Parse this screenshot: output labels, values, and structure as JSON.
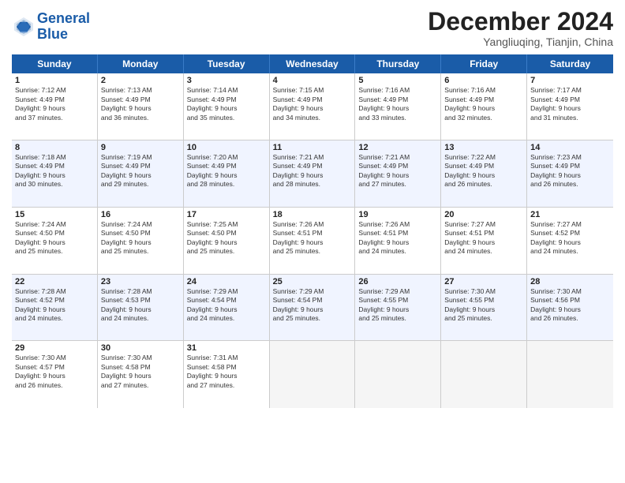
{
  "header": {
    "logo_line1": "General",
    "logo_line2": "Blue",
    "month_title": "December 2024",
    "location": "Yangliuqing, Tianjin, China"
  },
  "weekdays": [
    "Sunday",
    "Monday",
    "Tuesday",
    "Wednesday",
    "Thursday",
    "Friday",
    "Saturday"
  ],
  "weeks": [
    [
      {
        "day": "1",
        "lines": [
          "Sunrise: 7:12 AM",
          "Sunset: 4:49 PM",
          "Daylight: 9 hours",
          "and 37 minutes."
        ],
        "alt": false,
        "empty": false
      },
      {
        "day": "2",
        "lines": [
          "Sunrise: 7:13 AM",
          "Sunset: 4:49 PM",
          "Daylight: 9 hours",
          "and 36 minutes."
        ],
        "alt": false,
        "empty": false
      },
      {
        "day": "3",
        "lines": [
          "Sunrise: 7:14 AM",
          "Sunset: 4:49 PM",
          "Daylight: 9 hours",
          "and 35 minutes."
        ],
        "alt": false,
        "empty": false
      },
      {
        "day": "4",
        "lines": [
          "Sunrise: 7:15 AM",
          "Sunset: 4:49 PM",
          "Daylight: 9 hours",
          "and 34 minutes."
        ],
        "alt": false,
        "empty": false
      },
      {
        "day": "5",
        "lines": [
          "Sunrise: 7:16 AM",
          "Sunset: 4:49 PM",
          "Daylight: 9 hours",
          "and 33 minutes."
        ],
        "alt": false,
        "empty": false
      },
      {
        "day": "6",
        "lines": [
          "Sunrise: 7:16 AM",
          "Sunset: 4:49 PM",
          "Daylight: 9 hours",
          "and 32 minutes."
        ],
        "alt": false,
        "empty": false
      },
      {
        "day": "7",
        "lines": [
          "Sunrise: 7:17 AM",
          "Sunset: 4:49 PM",
          "Daylight: 9 hours",
          "and 31 minutes."
        ],
        "alt": false,
        "empty": false
      }
    ],
    [
      {
        "day": "8",
        "lines": [
          "Sunrise: 7:18 AM",
          "Sunset: 4:49 PM",
          "Daylight: 9 hours",
          "and 30 minutes."
        ],
        "alt": true,
        "empty": false
      },
      {
        "day": "9",
        "lines": [
          "Sunrise: 7:19 AM",
          "Sunset: 4:49 PM",
          "Daylight: 9 hours",
          "and 29 minutes."
        ],
        "alt": true,
        "empty": false
      },
      {
        "day": "10",
        "lines": [
          "Sunrise: 7:20 AM",
          "Sunset: 4:49 PM",
          "Daylight: 9 hours",
          "and 28 minutes."
        ],
        "alt": true,
        "empty": false
      },
      {
        "day": "11",
        "lines": [
          "Sunrise: 7:21 AM",
          "Sunset: 4:49 PM",
          "Daylight: 9 hours",
          "and 28 minutes."
        ],
        "alt": true,
        "empty": false
      },
      {
        "day": "12",
        "lines": [
          "Sunrise: 7:21 AM",
          "Sunset: 4:49 PM",
          "Daylight: 9 hours",
          "and 27 minutes."
        ],
        "alt": true,
        "empty": false
      },
      {
        "day": "13",
        "lines": [
          "Sunrise: 7:22 AM",
          "Sunset: 4:49 PM",
          "Daylight: 9 hours",
          "and 26 minutes."
        ],
        "alt": true,
        "empty": false
      },
      {
        "day": "14",
        "lines": [
          "Sunrise: 7:23 AM",
          "Sunset: 4:49 PM",
          "Daylight: 9 hours",
          "and 26 minutes."
        ],
        "alt": true,
        "empty": false
      }
    ],
    [
      {
        "day": "15",
        "lines": [
          "Sunrise: 7:24 AM",
          "Sunset: 4:50 PM",
          "Daylight: 9 hours",
          "and 25 minutes."
        ],
        "alt": false,
        "empty": false
      },
      {
        "day": "16",
        "lines": [
          "Sunrise: 7:24 AM",
          "Sunset: 4:50 PM",
          "Daylight: 9 hours",
          "and 25 minutes."
        ],
        "alt": false,
        "empty": false
      },
      {
        "day": "17",
        "lines": [
          "Sunrise: 7:25 AM",
          "Sunset: 4:50 PM",
          "Daylight: 9 hours",
          "and 25 minutes."
        ],
        "alt": false,
        "empty": false
      },
      {
        "day": "18",
        "lines": [
          "Sunrise: 7:26 AM",
          "Sunset: 4:51 PM",
          "Daylight: 9 hours",
          "and 25 minutes."
        ],
        "alt": false,
        "empty": false
      },
      {
        "day": "19",
        "lines": [
          "Sunrise: 7:26 AM",
          "Sunset: 4:51 PM",
          "Daylight: 9 hours",
          "and 24 minutes."
        ],
        "alt": false,
        "empty": false
      },
      {
        "day": "20",
        "lines": [
          "Sunrise: 7:27 AM",
          "Sunset: 4:51 PM",
          "Daylight: 9 hours",
          "and 24 minutes."
        ],
        "alt": false,
        "empty": false
      },
      {
        "day": "21",
        "lines": [
          "Sunrise: 7:27 AM",
          "Sunset: 4:52 PM",
          "Daylight: 9 hours",
          "and 24 minutes."
        ],
        "alt": false,
        "empty": false
      }
    ],
    [
      {
        "day": "22",
        "lines": [
          "Sunrise: 7:28 AM",
          "Sunset: 4:52 PM",
          "Daylight: 9 hours",
          "and 24 minutes."
        ],
        "alt": true,
        "empty": false
      },
      {
        "day": "23",
        "lines": [
          "Sunrise: 7:28 AM",
          "Sunset: 4:53 PM",
          "Daylight: 9 hours",
          "and 24 minutes."
        ],
        "alt": true,
        "empty": false
      },
      {
        "day": "24",
        "lines": [
          "Sunrise: 7:29 AM",
          "Sunset: 4:54 PM",
          "Daylight: 9 hours",
          "and 24 minutes."
        ],
        "alt": true,
        "empty": false
      },
      {
        "day": "25",
        "lines": [
          "Sunrise: 7:29 AM",
          "Sunset: 4:54 PM",
          "Daylight: 9 hours",
          "and 25 minutes."
        ],
        "alt": true,
        "empty": false
      },
      {
        "day": "26",
        "lines": [
          "Sunrise: 7:29 AM",
          "Sunset: 4:55 PM",
          "Daylight: 9 hours",
          "and 25 minutes."
        ],
        "alt": true,
        "empty": false
      },
      {
        "day": "27",
        "lines": [
          "Sunrise: 7:30 AM",
          "Sunset: 4:55 PM",
          "Daylight: 9 hours",
          "and 25 minutes."
        ],
        "alt": true,
        "empty": false
      },
      {
        "day": "28",
        "lines": [
          "Sunrise: 7:30 AM",
          "Sunset: 4:56 PM",
          "Daylight: 9 hours",
          "and 26 minutes."
        ],
        "alt": true,
        "empty": false
      }
    ],
    [
      {
        "day": "29",
        "lines": [
          "Sunrise: 7:30 AM",
          "Sunset: 4:57 PM",
          "Daylight: 9 hours",
          "and 26 minutes."
        ],
        "alt": false,
        "empty": false
      },
      {
        "day": "30",
        "lines": [
          "Sunrise: 7:30 AM",
          "Sunset: 4:58 PM",
          "Daylight: 9 hours",
          "and 27 minutes."
        ],
        "alt": false,
        "empty": false
      },
      {
        "day": "31",
        "lines": [
          "Sunrise: 7:31 AM",
          "Sunset: 4:58 PM",
          "Daylight: 9 hours",
          "and 27 minutes."
        ],
        "alt": false,
        "empty": false
      },
      {
        "day": "",
        "lines": [],
        "alt": false,
        "empty": true
      },
      {
        "day": "",
        "lines": [],
        "alt": false,
        "empty": true
      },
      {
        "day": "",
        "lines": [],
        "alt": false,
        "empty": true
      },
      {
        "day": "",
        "lines": [],
        "alt": false,
        "empty": true
      }
    ]
  ]
}
